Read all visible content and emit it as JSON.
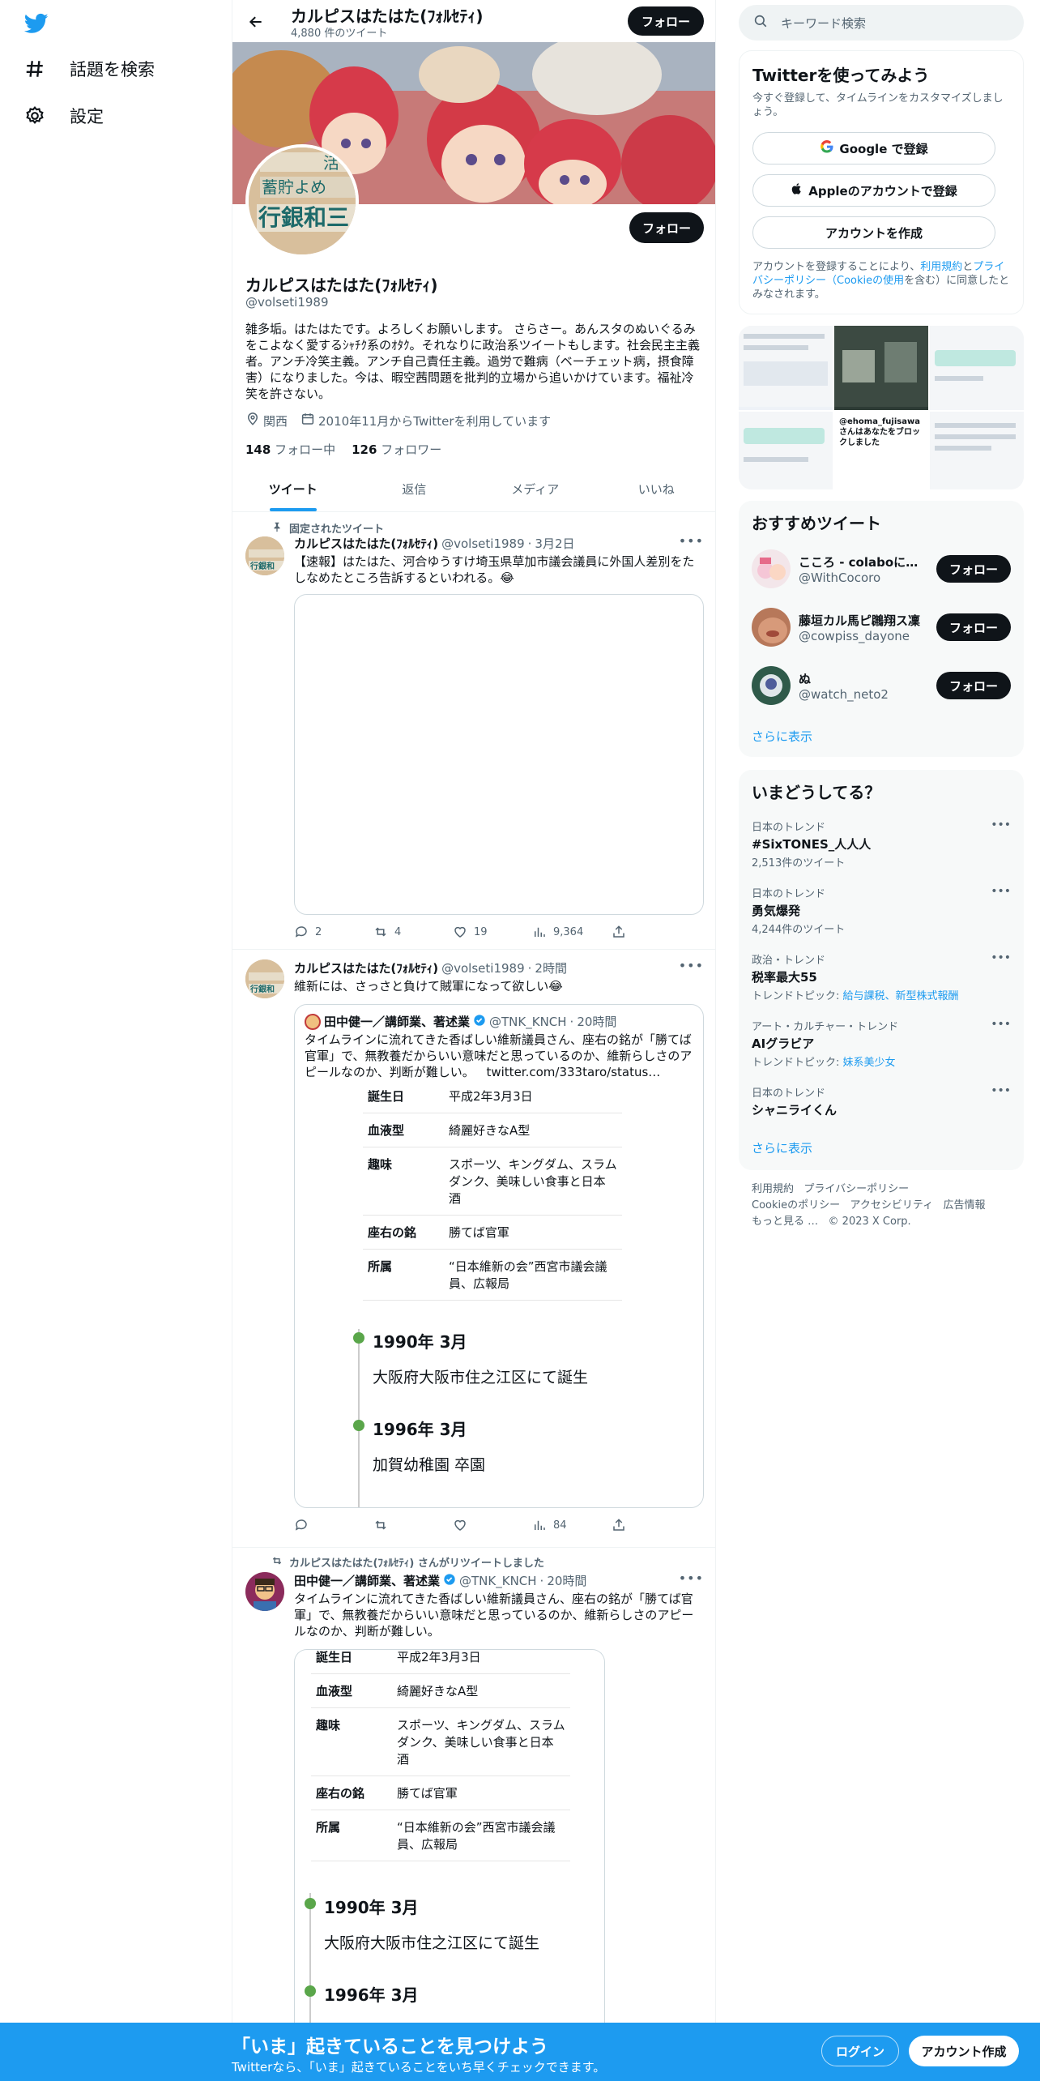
{
  "nav": {
    "explore_label": "話題を検索",
    "settings_label": "設定"
  },
  "header": {
    "name": "カルピスはたはた(ﾌｫﾙｾﾃｨ)",
    "tweet_count": "4,880 件のツイート",
    "follow_label": "フォロー"
  },
  "profile": {
    "avatar_sign_lines": [
      "活",
      "蓄貯よめ",
      "行銀和三"
    ],
    "name": "カルピスはたはた(ﾌｫﾙｾﾃｨ)",
    "handle": "@volseti1989",
    "follow_label": "フォロー",
    "bio": "雑多垢。はたはたです。よろしくお願いします。 さらさー。あんスタのぬいぐるみをこよなく愛するｼｬﾁｸ系のｵﾀｸ。それなりに政治系ツイートもします。社会民主主義者。アンチ冷笑主義。アンチ自己責任主義。過労で難病（ベーチェット病，摂食障害）になりました。今は、暇空茜問題を批判的立場から追いかけています。福祉冷笑を許さない。",
    "location": "関西",
    "joined": "2010年11月からTwitterを利用しています",
    "following_count": "148",
    "following_label": "フォロー中",
    "followers_count": "126",
    "followers_label": "フォロワー"
  },
  "tabs": [
    {
      "label": "ツイート"
    },
    {
      "label": "返信"
    },
    {
      "label": "メディア"
    },
    {
      "label": "いいね"
    }
  ],
  "tweets": [
    {
      "pinned_label": "固定されたツイート",
      "name": "カルピスはたはた(ﾌｫﾙｾﾃｨ)",
      "handle": "@volseti1989",
      "time": "3月2日",
      "text": "【速報】はたはた、河合ゆうすけ埼玉県草加市議会議員に外国人差別をたしなめたところ告訴するといわれる。😂",
      "replies": "2",
      "retweets": "4",
      "likes": "19",
      "views": "9,364"
    },
    {
      "name": "カルピスはたはた(ﾌｫﾙｾﾃｨ)",
      "handle": "@volseti1989",
      "time": "2時間",
      "text": "維新には、さっさと負けて賊軍になって欲しい😂",
      "views": "84",
      "quote": {
        "name": "田中健一／講師業、著述業",
        "handle": "@TNK_KNCH",
        "time": "20時間",
        "text": "タイムラインに流れてきた香ばしい維新議員さん、座右の銘が「勝てば官軍」で、無教養だからいい意味だと思っているのか、維新らしさのアピールなのか、判断が難しい。",
        "link": "twitter.com/333taro/status…"
      }
    },
    {
      "retweet_context": "カルピスはたはた(ﾌｫﾙｾﾃｨ) さんがリツイートしました",
      "name": "田中健一／講師業、著述業",
      "handle": "@TNK_KNCH",
      "time": "20時間",
      "text": "タイムラインに流れてきた香ばしい維新議員さん、座右の銘が「勝てば官軍」で、無教養だからいい意味だと思っているのか、維新らしさのアピールなのか、判断が難しい。"
    }
  ],
  "profile_card": {
    "rows": [
      {
        "k": "誕生日",
        "v": "平成2年3月3日"
      },
      {
        "k": "血液型",
        "v": "綺麗好きなA型"
      },
      {
        "k": "趣味",
        "v": "スポーツ、キングダム、スラムダンク、美味しい食事と日本酒"
      },
      {
        "k": "座右の銘",
        "v": "勝てば官軍"
      },
      {
        "k": "所属",
        "v": "“日本維新の会”西宮市議会議員、広報局"
      }
    ],
    "timeline": [
      {
        "year": "1990年 3月",
        "desc": "大阪府大阪市住之江区にて誕生"
      },
      {
        "year": "1996年 3月",
        "desc": "加賀幼稚園 卒園"
      }
    ]
  },
  "search": {
    "placeholder": "キーワード検索"
  },
  "signup_card": {
    "title": "Twitterを使ってみよう",
    "subtitle": "今すぐ登録して、タイムラインをカスタマイズしましょう。",
    "google": "Google で登録",
    "apple": "Appleのアカウントで登録",
    "create": "アカウントを作成",
    "legal_prefix": "アカウントを登録することにより、",
    "terms": "利用規約",
    "and": "と",
    "privacy": "プライバシーポリシー（Cookieの使用",
    "legal_suffix": "を含む）に同意したとみなされます。"
  },
  "media_strip": {
    "caption": "@ehoma_fujisawa さんはあなたをブロックしました"
  },
  "recommend": {
    "title": "おすすめツイート",
    "follow_label": "フォロー",
    "users": [
      {
        "name": "こころ - colaboに連…",
        "handle": "@WithCocoro"
      },
      {
        "name": "藤垣カル馬ピ鸊翔ス凜",
        "handle": "@cowpiss_dayone"
      },
      {
        "name": "ぬ",
        "handle": "@watch_neto2"
      }
    ],
    "more": "さらに表示"
  },
  "trends": {
    "title": "いまどうしてる？",
    "items": [
      {
        "ctx": "日本のトレンド",
        "title": "#SixTONES_人人人",
        "count": "2,513件のツイート"
      },
      {
        "ctx": "日本のトレンド",
        "title": "勇気爆発",
        "count": "4,244件のツイート"
      },
      {
        "ctx": "政治・トレンド",
        "title": "税率最大55",
        "topic_label": "トレンドトピック: ",
        "topic": "給与課税、新型株式報酬"
      },
      {
        "ctx": "アート・カルチャー・トレンド",
        "title": "AIグラビア",
        "topic_label": "トレンドトピック: ",
        "topic": "妹系美少女"
      },
      {
        "ctx": "日本のトレンド",
        "title": "シャニライくん"
      }
    ],
    "more": "さらに表示"
  },
  "footer": {
    "terms": "利用規約",
    "privacy": "プライバシーポリシー",
    "cookie": "Cookieのポリシー",
    "access": "アクセシビリティ",
    "ads": "広告情報",
    "more": "もっと見る …",
    "copy": "© 2023 X Corp."
  },
  "bottom": {
    "title": "「いま」起きていることを見つけよう",
    "subtitle": "Twitterなら、「いま」起きていることをいち早くチェックできます。",
    "login": "ログイン",
    "signup": "アカウント作成"
  },
  "colors": {
    "brand": "#1d9bf0",
    "text": "#0f1419",
    "muted": "#536471"
  }
}
